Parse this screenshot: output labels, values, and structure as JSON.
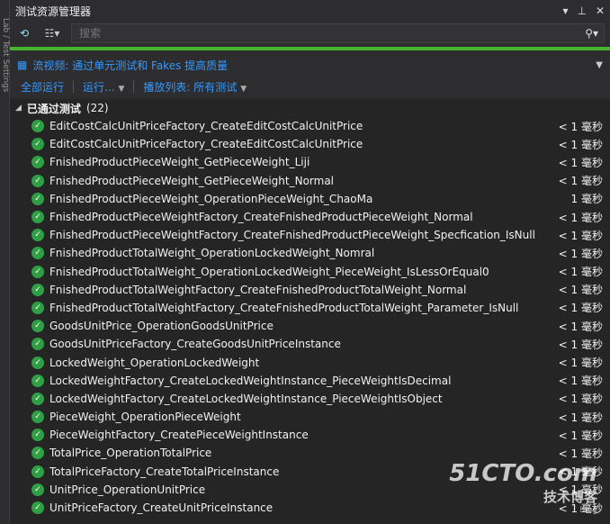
{
  "window": {
    "title": "测试资源管理器",
    "side_tab": "Lab / Test Settings"
  },
  "toolbar": {
    "search_placeholder": "搜索"
  },
  "status_color": "#45b52e",
  "infobar": {
    "link": "流视频: 通过单元测试和 Fakes 提高质量"
  },
  "actions": {
    "run_all": "全部运行",
    "run": "运行...",
    "playlist": "播放列表: 所有测试"
  },
  "group": {
    "label": "已通过测试",
    "count": "(22)"
  },
  "tests": [
    {
      "name": "EditCostCalcUnitPriceFactory_CreateEditCostCalcUnitPrice",
      "duration": "< 1 毫秒"
    },
    {
      "name": "EditCostCalcUnitPriceFactory_CreateEditCostCalcUnitPrice",
      "duration": "< 1 毫秒"
    },
    {
      "name": "FnishedProductPieceWeight_GetPieceWeight_Liji",
      "duration": "< 1 毫秒"
    },
    {
      "name": "FnishedProductPieceWeight_GetPieceWeight_Normal",
      "duration": "< 1 毫秒"
    },
    {
      "name": "FnishedProductPieceWeight_OperationPieceWeight_ChaoMa",
      "duration": "1 毫秒"
    },
    {
      "name": "FnishedProductPieceWeightFactory_CreateFnishedProductPieceWeight_Normal",
      "duration": "< 1 毫秒"
    },
    {
      "name": "FnishedProductPieceWeightFactory_CreateFnishedProductPieceWeight_Specfication_IsNull",
      "duration": "< 1 毫秒"
    },
    {
      "name": "FnishedProductTotalWeight_OperationLockedWeight_Nomral",
      "duration": "< 1 毫秒"
    },
    {
      "name": "FnishedProductTotalWeight_OperationLockedWeight_PieceWeight_IsLessOrEqual0",
      "duration": "< 1 毫秒"
    },
    {
      "name": "FnishedProductTotalWeightFactory_CreateFnishedProductTotalWeight_Normal",
      "duration": "< 1 毫秒"
    },
    {
      "name": "FnishedProductTotalWeightFactory_CreateFnishedProductTotalWeight_Parameter_IsNull",
      "duration": "< 1 毫秒"
    },
    {
      "name": "GoodsUnitPrice_OperationGoodsUnitPrice",
      "duration": "< 1 毫秒"
    },
    {
      "name": "GoodsUnitPriceFactory_CreateGoodsUnitPriceInstance",
      "duration": "< 1 毫秒"
    },
    {
      "name": "LockedWeight_OperationLockedWeight",
      "duration": "< 1 毫秒"
    },
    {
      "name": "LockedWeightFactory_CreateLockedWeightInstance_PieceWeightIsDecimal",
      "duration": "< 1 毫秒"
    },
    {
      "name": "LockedWeightFactory_CreateLockedWeightInstance_PieceWeightIsObject",
      "duration": "< 1 毫秒"
    },
    {
      "name": "PieceWeight_OperationPieceWeight",
      "duration": "< 1 毫秒"
    },
    {
      "name": "PieceWeightFactory_CreatePieceWeightInstance",
      "duration": "< 1 毫秒"
    },
    {
      "name": "TotalPrice_OperationTotalPrice",
      "duration": "< 1 毫秒"
    },
    {
      "name": "TotalPriceFactory_CreateTotalPriceInstance",
      "duration": "< 1 毫秒"
    },
    {
      "name": "UnitPrice_OperationUnitPrice",
      "duration": "< 1 毫秒"
    },
    {
      "name": "UnitPriceFactory_CreateUnitPriceInstance",
      "duration": "< 1 毫秒"
    }
  ],
  "watermark": {
    "line1": "51CTO.com",
    "line2": "技术博客",
    "line3": "Blog"
  }
}
